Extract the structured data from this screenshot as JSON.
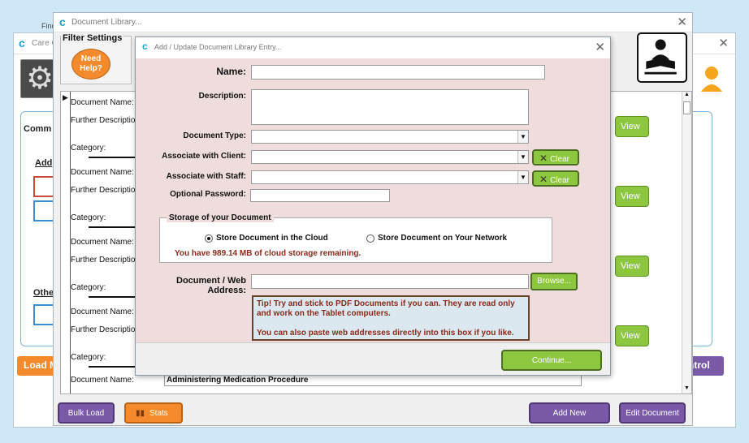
{
  "main_window": {
    "title": "Care C",
    "find_text": "Find",
    "comm_label": "Comm",
    "add_label": "Add",
    "other_label": "Othe",
    "load_label": "Load M",
    "control_label": "ntrol"
  },
  "library_window": {
    "title": "Document Library...",
    "filter_title": "Filter Settings",
    "need_help": "Need Help?",
    "view_label": "View",
    "rows": [
      {
        "name_label": "Document Name:",
        "desc_label": "Further Descriptio",
        "cat_label": "Category:"
      },
      {
        "name_label": "Document Name:",
        "desc_label": "Further Descriptio",
        "cat_label": "Category:"
      },
      {
        "name_label": "Document Name:",
        "desc_label": "Further Descriptio",
        "cat_label": "Category:"
      },
      {
        "name_label": "Document Name:",
        "desc_label": "Further Descriptio",
        "cat_label": "Category:"
      }
    ],
    "last_row_label": "Document Name:",
    "last_row_value": "Administering Medication Procedure",
    "bulk_load": "Bulk Load",
    "stats": "Stats",
    "add_new": "Add New",
    "edit_document": "Edit Document"
  },
  "dialog": {
    "title": "Add / Update Document Library Entry...",
    "name_label": "Name:",
    "name_value": "",
    "description_label": "Description:",
    "description_value": "",
    "doc_type_label": "Document Type:",
    "doc_type_value": "",
    "client_label": "Associate with Client:",
    "client_value": "",
    "staff_label": "Associate with Staff:",
    "staff_value": "",
    "clear_label": "Clear",
    "password_label": "Optional Password:",
    "password_value": "",
    "storage_title": "Storage of your Document",
    "storage_options": [
      "Store Document in the Cloud",
      "Store Document on Your Network"
    ],
    "storage_selected": 0,
    "remaining": "You have 989.14 MB of cloud storage remaining.",
    "address_label": "Document / Web Address:",
    "address_value": "",
    "browse": "Browse...",
    "tip_line1": "Tip!  Try and stick to PDF Documents if you can.  They are read only and work on the Tablet computers.",
    "tip_line2": "You can also paste web addresses directly into this box if you like.",
    "continue": "Continue..."
  },
  "colors": {
    "dialog_bg": "#efdddd",
    "green_button": "#8dc63f",
    "purple_button": "#7a5aa6",
    "orange_button": "#f58a2c"
  }
}
